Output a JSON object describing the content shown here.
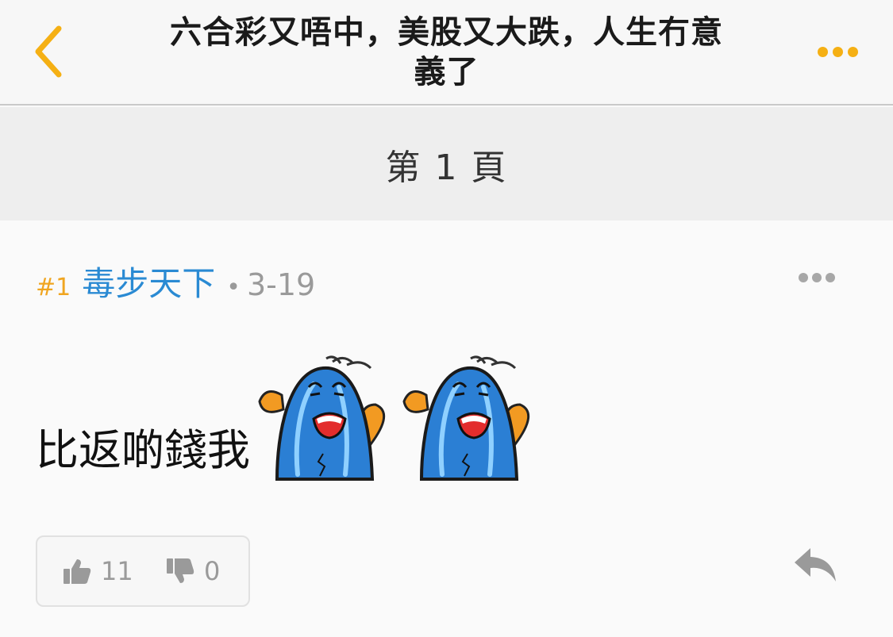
{
  "header": {
    "title_line1": "六合彩又唔中，美股又大跌，人生冇意",
    "title_line2": "義了",
    "back_icon": "chevron-left-icon",
    "more_icon": "ellipsis-horizontal-icon",
    "accent_color": "#f5b014"
  },
  "page_bar": {
    "label": "第 1 頁"
  },
  "post": {
    "number": "#1",
    "username": "毒步天下",
    "separator": "•",
    "date": "3-19",
    "text": "比返啲錢我",
    "stickers": [
      "crying-blue-creature-sticker",
      "crying-blue-creature-sticker"
    ],
    "likes": "11",
    "dislikes": "0",
    "username_color": "#2a8ad3",
    "number_color": "#f0a520"
  }
}
